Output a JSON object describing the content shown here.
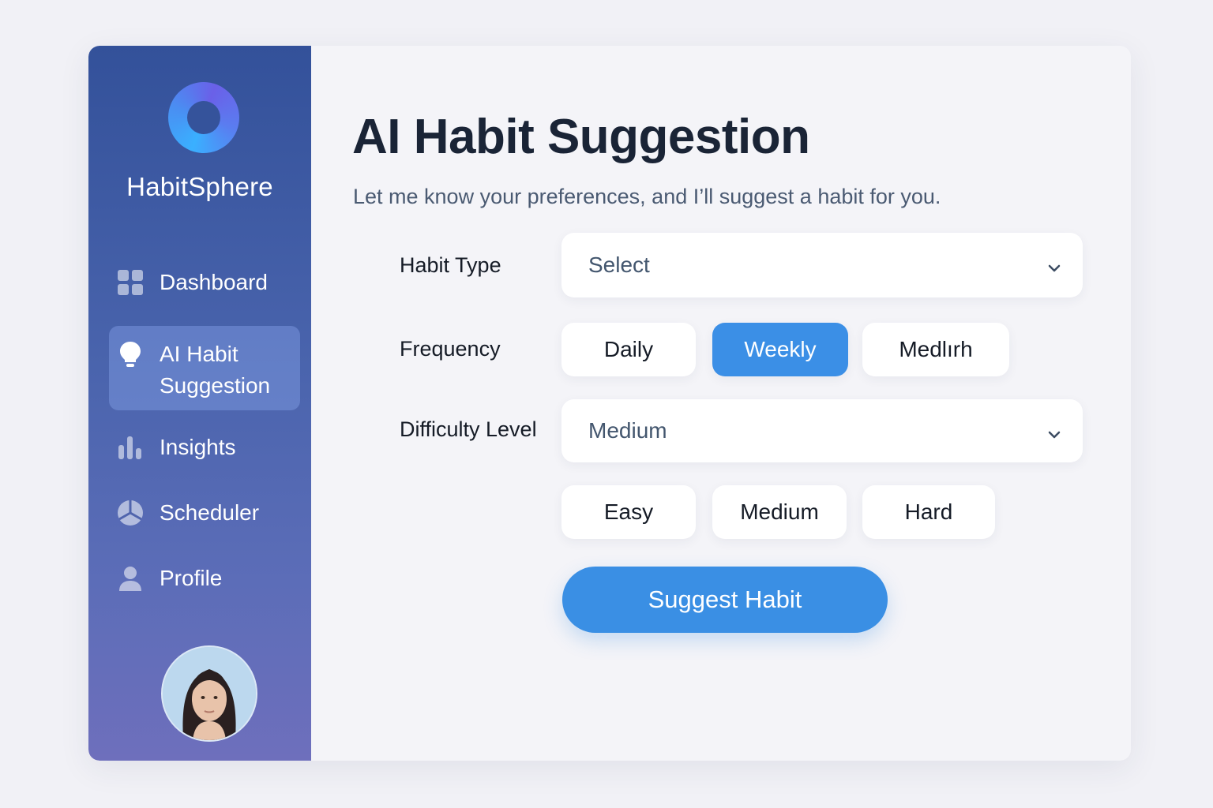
{
  "app": {
    "name": "HabitSphere"
  },
  "sidebar": {
    "items": [
      {
        "label": "Dashboard",
        "icon": "grid-icon"
      },
      {
        "label": "AI Habit Suggestion",
        "line1": "AI Habit",
        "line2": "Suggestion",
        "icon": "lightbulb-icon",
        "active": true
      },
      {
        "label": "Insights",
        "icon": "bar-chart-icon"
      },
      {
        "label": "Scheduler",
        "icon": "pie-chart-icon"
      },
      {
        "label": "Profile",
        "icon": "user-icon"
      }
    ],
    "avatar": "user-avatar"
  },
  "main": {
    "title": "AI Habit Suggestion",
    "subtitle": "Let me know your preferences, and I’ll suggest a habit for you.",
    "habit_type": {
      "label": "Habit Type",
      "value": "Select"
    },
    "frequency": {
      "label": "Frequency",
      "options": [
        "Daily",
        "Weekly",
        "Medlırh"
      ],
      "selected": "Weekly"
    },
    "difficulty": {
      "label": "Difficulty Level",
      "value": "Medium",
      "options": [
        "Easy",
        "Medium",
        "Hard"
      ]
    },
    "suggest_button": "Suggest Habit"
  },
  "colors": {
    "accent": "#3b8fe6",
    "sidebar_top": "#33519a",
    "sidebar_bottom": "#6e6fbc",
    "title": "#1a2436",
    "background": "#f1f1f6"
  }
}
